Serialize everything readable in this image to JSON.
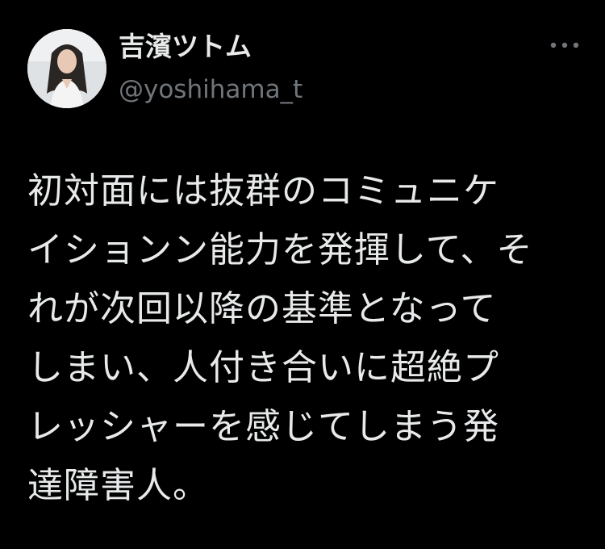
{
  "author": {
    "display_name": "吉濱ツトム",
    "handle": "@yoshihama_t",
    "avatar_icon": "profile-photo"
  },
  "menu": {
    "icon": "more-options-icon"
  },
  "tweet": {
    "lines": [
      "初対面には抜群のコミュニケ",
      "イションン能力を発揮して、そ",
      "れが次回以降の基準となって",
      "しまい、人付き合いに超絶プ",
      "レッシャーを感じてしまう発",
      "達障害人。"
    ]
  },
  "colors": {
    "background": "#000000",
    "text_primary": "#e7e9ea",
    "text_secondary": "#71767b"
  }
}
